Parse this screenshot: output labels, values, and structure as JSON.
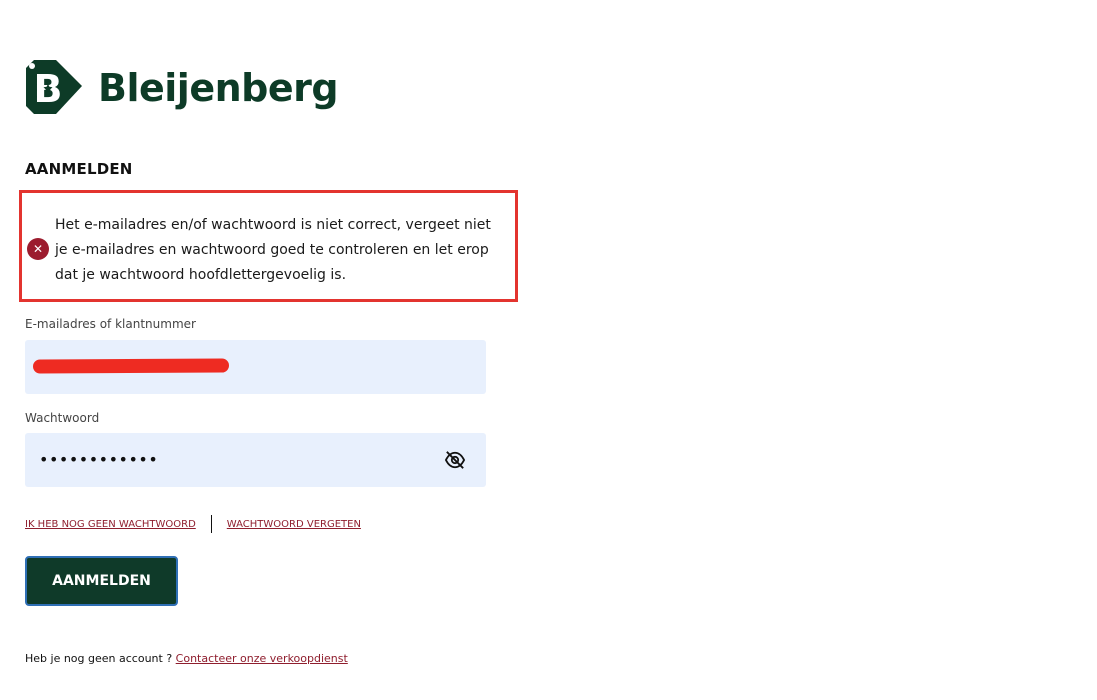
{
  "brand": {
    "name": "Bleijenberg",
    "color": "#0d3b27"
  },
  "page": {
    "title": "AANMELDEN"
  },
  "error": {
    "icon": "error-x-icon",
    "line1": "Het e-mailadres en/of wachtwoord is niet correct, vergeet niet",
    "line2": "je e-mailadres en wachtwoord goed te controleren en let erop",
    "line3": "dat je wachtwoord hoofdlettergevoelig is.",
    "highlight_color": "#e3342f"
  },
  "email": {
    "label": "E-mailadres of klantnummer",
    "value_redacted": true
  },
  "password": {
    "label": "Wachtwoord",
    "value": "••••••••••••",
    "toggle_icon": "eye-slash-icon"
  },
  "links": {
    "no_password": "IK HEB NOG GEEN WACHTWOORD",
    "forgot_password": "WACHTWOORD VERGETEN"
  },
  "submit": {
    "label": "AANMELDEN"
  },
  "footer": {
    "text": "Heb je nog geen account ? ",
    "link": "Contacteer onze verkoopdienst"
  }
}
